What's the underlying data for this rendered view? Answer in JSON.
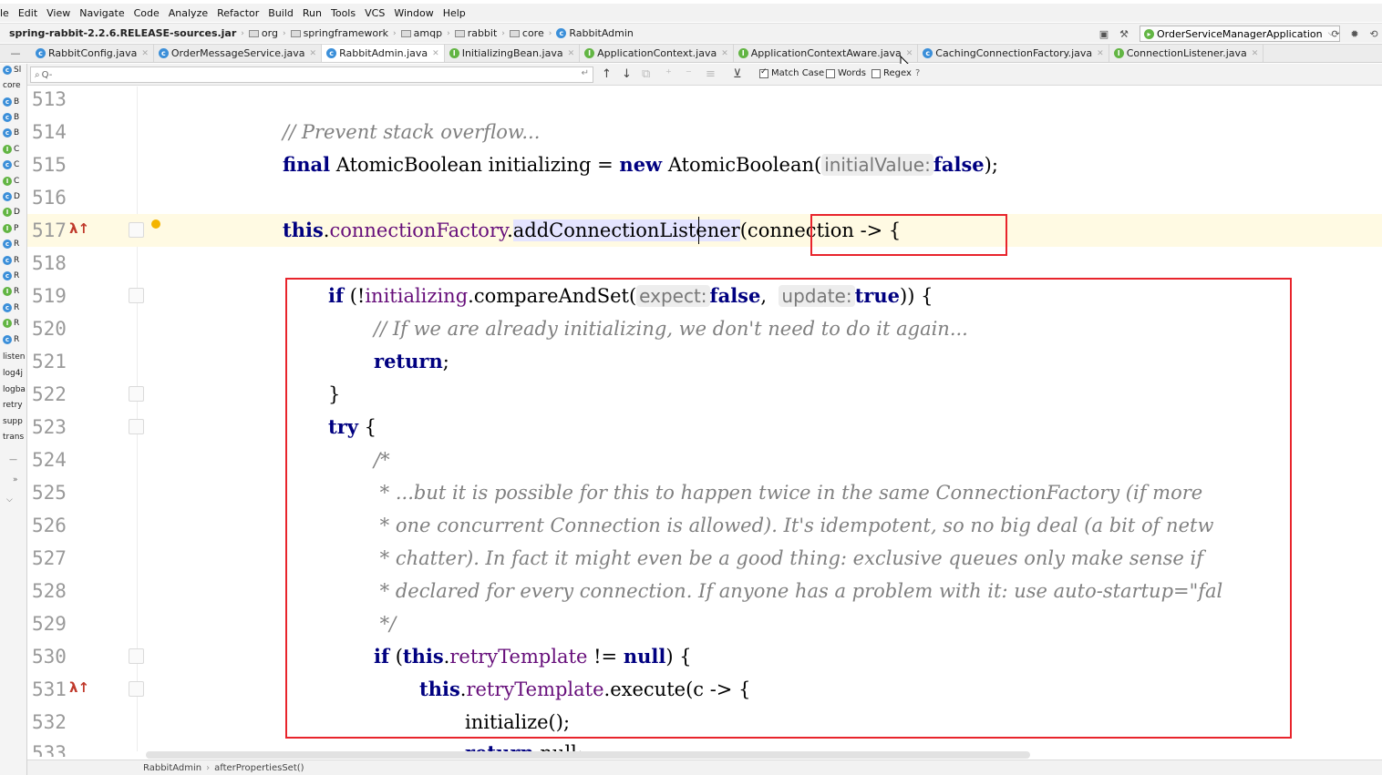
{
  "menu": [
    "le",
    "Edit",
    "View",
    "Navigate",
    "Code",
    "Analyze",
    "Refactor",
    "Build",
    "Run",
    "Tools",
    "VCS",
    "Window",
    "Help"
  ],
  "breadcrumbs": [
    {
      "label": "spring-rabbit-2.2.6.RELEASE-sources.jar",
      "icon": "jar-icon",
      "bold": true
    },
    {
      "label": "org",
      "icon": "folder-icon"
    },
    {
      "label": "springframework",
      "icon": "folder-icon"
    },
    {
      "label": "amqp",
      "icon": "folder-icon"
    },
    {
      "label": "rabbit",
      "icon": "folder-icon"
    },
    {
      "label": "core",
      "icon": "folder-icon"
    },
    {
      "label": "RabbitAdmin",
      "icon": "class-icon"
    }
  ],
  "run_config": "OrderServiceManagerApplication",
  "tabs": [
    {
      "label": "RabbitConfig.java",
      "kind": "class",
      "active": false
    },
    {
      "label": "OrderMessageService.java",
      "kind": "class",
      "active": false
    },
    {
      "label": "RabbitAdmin.java",
      "kind": "class",
      "active": true
    },
    {
      "label": "InitializingBean.java",
      "kind": "interface",
      "active": false
    },
    {
      "label": "ApplicationContext.java",
      "kind": "interface",
      "active": false
    },
    {
      "label": "ApplicationContextAware.java",
      "kind": "interface",
      "active": false
    },
    {
      "label": "CachingConnectionFactory.java",
      "kind": "class",
      "active": false
    },
    {
      "label": "ConnectionListener.java",
      "kind": "interface",
      "active": false
    }
  ],
  "find": {
    "placeholder": "Q-",
    "match_case_label": "Match Case",
    "match_case_checked": true,
    "words_label": "Words",
    "words_checked": false,
    "regex_label": "Regex",
    "regex_checked": false,
    "help": "?"
  },
  "project_strip": {
    "items": [
      "Sl",
      "core",
      "B",
      "B",
      "B",
      "C",
      "C",
      "C",
      "D",
      "D",
      "P",
      "R",
      "R",
      "R",
      "R",
      "R",
      "R",
      "R",
      "listen",
      "log4j",
      "logba",
      "retry",
      "supp",
      "trans"
    ]
  },
  "line_numbers": [
    "513",
    "514",
    "515",
    "516",
    "517",
    "518",
    "519",
    "520",
    "521",
    "522",
    "523",
    "524",
    "525",
    "526",
    "527",
    "528",
    "529",
    "530",
    "531",
    "532",
    "533"
  ],
  "code": {
    "l514": "// Prevent stack overflow...",
    "l515_kw1": "final",
    "l515_type": " AtomicBoolean initializing = ",
    "l515_kw2": "new",
    "l515_call": " AtomicBoolean(",
    "l515_hint": "initialValue:",
    "l515_val": "false",
    "l515_end": ");",
    "l517_this": "this",
    "l517_dot": ".",
    "l517_field": "connectionFactory",
    "l517_dot2": ".",
    "l517_method": "addConnectionListener",
    "l517_rest": "(connection -> {",
    "l519_kw": "if",
    "l519_a": " (!",
    "l519_field": "initializing",
    "l519_b": ".compareAndSet(",
    "l519_hint1": "expect:",
    "l519_v1": "false",
    "l519_c": ",  ",
    "l519_hint2": "update:",
    "l519_v2": "true",
    "l519_d": ")) {",
    "l520": "// If we are already initializing, we don't need to do it again...",
    "l521_kw": "return",
    "l521_end": ";",
    "l522": "}",
    "l523_kw": "try",
    "l523_end": " {",
    "l524": "/*",
    "l525": " * ...but it is possible for this to happen twice in the same ConnectionFactory (if more",
    "l526": " * one concurrent Connection is allowed). It's idempotent, so no big deal (a bit of netw",
    "l527": " * chatter). In fact it might even be a good thing: exclusive queues only make sense if",
    "l528": " * declared for every connection. If anyone has a problem with it: use auto-startup=\"fal",
    "l529": " */",
    "l530_kw": "if",
    "l530_a": " (",
    "l530_this": "this",
    "l530_dot": ".",
    "l530_field": "retryTemplate",
    "l530_b": " != ",
    "l530_null": "null",
    "l530_c": ") {",
    "l531_this": "this",
    "l531_dot": ".",
    "l531_field": "retryTemplate",
    "l531_rest": ".execute(c -> {",
    "l532": "initialize();",
    "l533_kw": "return",
    "l533_rest": " null;"
  },
  "gutter_markers": {
    "lambda_icon": "λ↑"
  },
  "status": {
    "crumb1": "RabbitAdmin",
    "crumb2": "afterPropertiesSet()"
  },
  "colors": {
    "keyword": "#000080",
    "comment": "#808080",
    "field": "#660e7a",
    "highlight_box": "#e8242c",
    "current_line": "#fffae3"
  }
}
